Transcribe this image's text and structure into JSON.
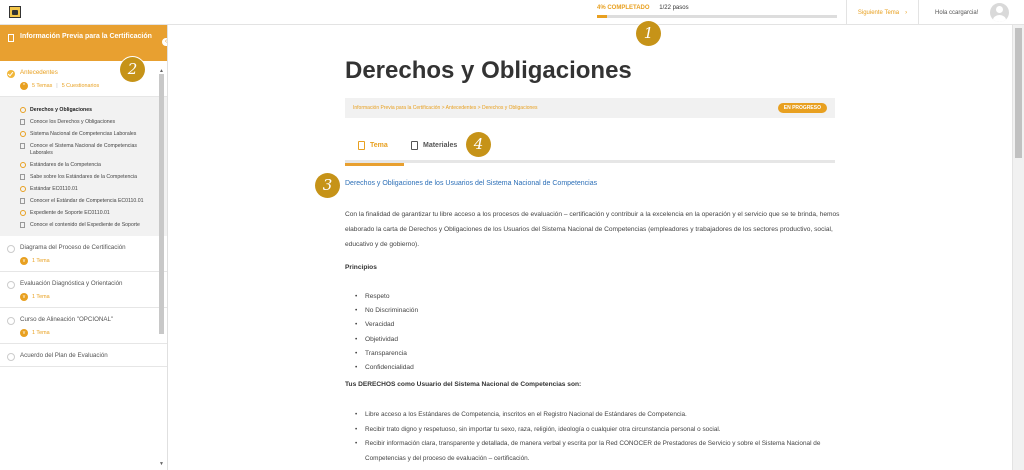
{
  "topbar": {
    "logo_icon": "course-logo-icon",
    "progress_label": "4% COMPLETADO",
    "progress_steps": "1/22 pasos",
    "progress_percent": 4,
    "next_topic": "Siguiente Tema",
    "next_icon": "chevron-right-icon",
    "greeting": "Hola ccargarcia!"
  },
  "sidebar": {
    "section_title": "Información Previa para la Certificación",
    "lessons": [
      {
        "title": "Antecedentes",
        "status": "completed",
        "temas": "5 Temas",
        "cuestionarios": "5 Cuestionarios",
        "topics": [
          "Derechos y Obligaciones",
          "Conoce los Derechos y Obligaciones",
          "Sistema Nacional de Competencias Laborales",
          "Conoce el Sistema Nacional de Competencias Laborales",
          "Estándares de la Competencia",
          "Sabe sobre los Estándares de la Competencia",
          "Estándar EC0110.01",
          "Conocer el Estándar de Competencia EC0110.01",
          "Expediente de Soporte EC0110.01",
          "Conoce el contenido del Expediente de Soporte"
        ]
      },
      {
        "title": "Diagrama del Proceso de Certificación",
        "temas": "1 Tema"
      },
      {
        "title": "Evaluación Diagnóstica y Orientación",
        "temas": "1 Tema"
      },
      {
        "title": "Curso de Alineación \"OPCIONAL\"",
        "temas": "1 Tema"
      },
      {
        "title": "Acuerdo del Plan de Evaluación"
      }
    ]
  },
  "main": {
    "title": "Derechos y Obligaciones",
    "breadcrumb": "Información Previa para la Certificación > Antecedentes > Derechos y Obligaciones",
    "status": "EN PROGRESO",
    "tabs": [
      {
        "label": "Tema",
        "icon": "document-icon"
      },
      {
        "label": "Materiales",
        "icon": "book-icon"
      }
    ],
    "subheading": "Derechos y Obligaciones de los Usuarios del Sistema Nacional de Competencias",
    "intro": "Con la finalidad de garantizar tu libre acceso a los procesos de evaluación – certificación y contribuir a la excelencia en la operación y el servicio que se te brinda, hemos elaborado la carta de Derechos y Obligaciones de los Usuarios del Sistema Nacional de Competencias (empleadores y trabajadores de los sectores productivo, social, educativo y de gobierno).",
    "principios_title": "Principios",
    "principios": [
      "Respeto",
      "No Discriminación",
      "Veracidad",
      "Objetividad",
      "Transparencia",
      "Confidencialidad"
    ],
    "derechos_title": "Tus DERECHOS como Usuario del Sistema Nacional de Competencias son:",
    "derechos": [
      "Libre acceso a los Estándares de Competencia, inscritos en el Registro Nacional de Estándares de Competencia.",
      "Recibir trato digno y respetuoso, sin importar tu sexo, raza, religión, ideología o cualquier otra circunstancia personal o social.",
      "Recibir información clara, transparente y detallada, de manera verbal y escrita por la Red CONOCER de Prestadores de Servicio y sobre el Sistema Nacional de Competencias y del proceso de evaluación – certificación."
    ]
  },
  "callouts": [
    "1",
    "2",
    "3",
    "4"
  ],
  "colors": {
    "accent": "#e8a020",
    "link": "#2c6fb7",
    "callout": "#c69318"
  }
}
